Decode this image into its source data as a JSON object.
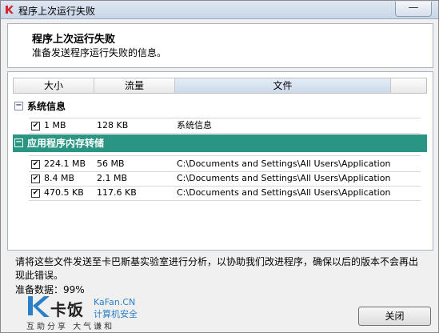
{
  "window": {
    "title": "程序上次运行失败",
    "close_glyph": "—"
  },
  "header": {
    "title": "程序上次运行失败",
    "subtitle": "准备发送程序运行失败的信息。"
  },
  "columns": [
    "大小",
    "流量",
    "文件",
    ""
  ],
  "groups": [
    {
      "toggle": "−",
      "label": "系统信息",
      "selected": false,
      "rows": [
        {
          "checked": "✔",
          "size": "1 MB",
          "traffic": "128 KB",
          "file": "系统信息"
        }
      ]
    },
    {
      "toggle": "−",
      "label": "应用程序内存转储",
      "selected": true,
      "rows": [
        {
          "checked": "✔",
          "size": "224.1 MB",
          "traffic": "56 MB",
          "file": "C:\\Documents and Settings\\All Users\\Application Dat..."
        },
        {
          "checked": "✔",
          "size": "8.4 MB",
          "traffic": "2.1 MB",
          "file": "C:\\Documents and Settings\\All Users\\Application Dat..."
        },
        {
          "checked": "✔",
          "size": "470.5 KB",
          "traffic": "117.6 KB",
          "file": "C:\\Documents and Settings\\All Users\\Application Dat..."
        }
      ]
    }
  ],
  "notice": "请将这些文件发送至卡巴斯基实验室进行分析，以协助我们改进程序，确保以后的版本不会再出现此错误。",
  "progress_text": "准备数据：99%",
  "logo": {
    "name": "卡饭",
    "domain": "KaFan.CN",
    "tagline": "计算机安全",
    "slogan": "互助分享 大气谦和"
  },
  "buttons": {
    "close_label": "关闭"
  },
  "colors": {
    "accent": "#2b9583",
    "logo_blue": "#2c80c8",
    "kaspersky_red": "#d6262b"
  }
}
